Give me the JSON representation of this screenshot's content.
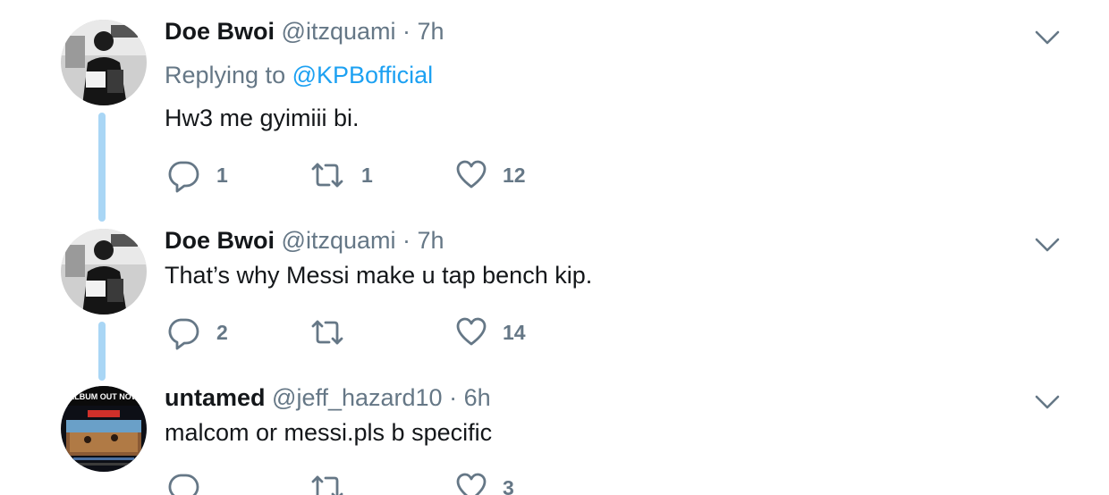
{
  "tweets": [
    {
      "name": "Doe Bwoi",
      "handle": "@itzquami",
      "separator": "·",
      "time": "7h",
      "replying_prefix": "Replying to",
      "replying_to": "@KPBofficial",
      "text": "Hw3 me gyimiii bi.",
      "reply_count": "1",
      "retweet_count": "1",
      "like_count": "12"
    },
    {
      "name": "Doe Bwoi",
      "handle": "@itzquami",
      "separator": "·",
      "time": "7h",
      "text": "That’s why Messi make u tap bench kip.",
      "reply_count": "2",
      "retweet_count": "",
      "like_count": "14"
    },
    {
      "name": "untamed",
      "handle": "@jeff_hazard10",
      "separator": "·",
      "time": "6h",
      "text": "malcom or messi.pls b specific",
      "avatar_text": "ALBUM OUT NOW",
      "reply_count": "",
      "retweet_count": "",
      "like_count": "3"
    }
  ],
  "icons": {
    "reply": "reply-icon",
    "retweet": "retweet-icon",
    "like": "heart-icon",
    "more": "chevron-down-icon"
  },
  "colors": {
    "name": "#14171a",
    "muted": "#657786",
    "link": "#1da1f2",
    "thread_line": "#a9d6f5"
  }
}
